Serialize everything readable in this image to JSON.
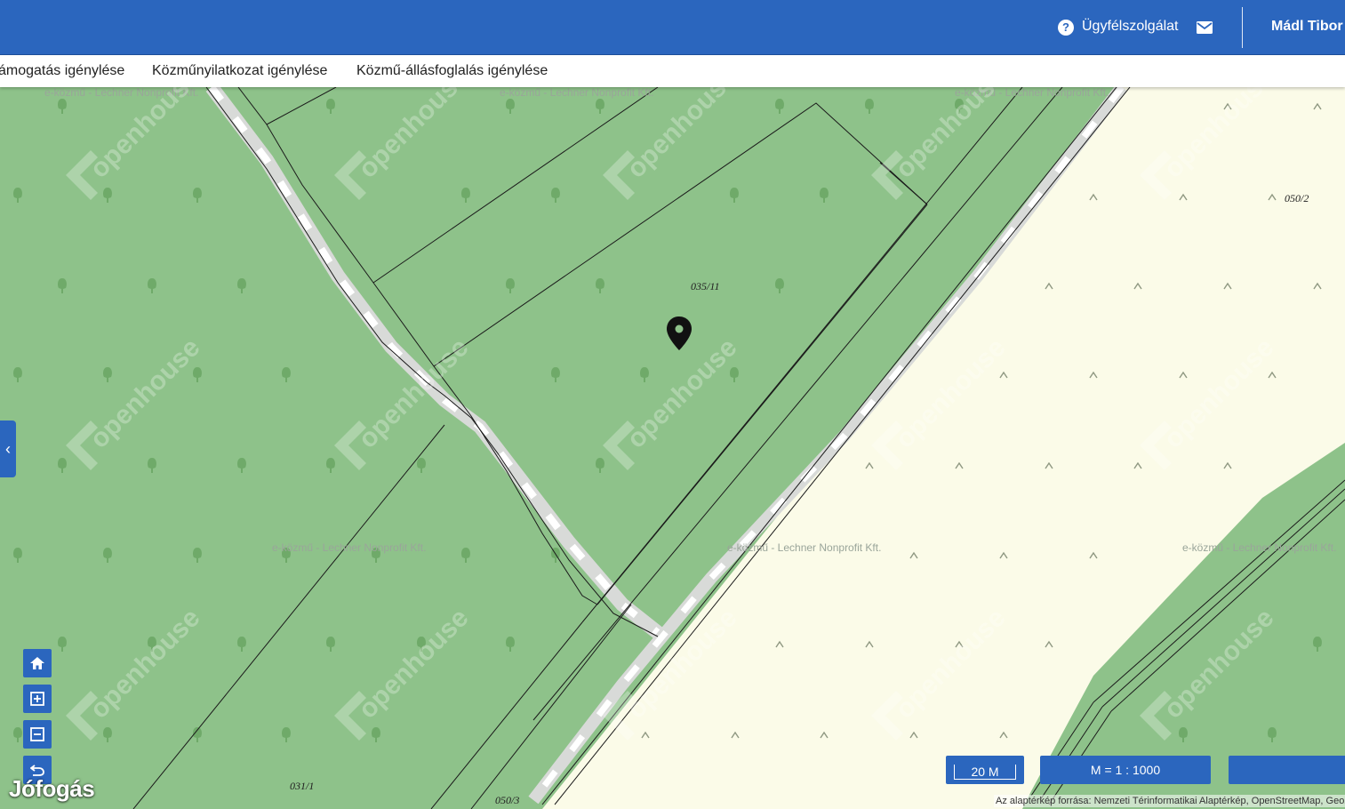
{
  "header": {
    "help_icon": "?",
    "help_label": "Ügyfélszolgálat",
    "mail_icon": "mail-icon",
    "user_name": "Mádl Tibor I"
  },
  "menu": {
    "items": [
      {
        "label": "ámogatás igénylése"
      },
      {
        "label": "Közműnyilatkozat igénylése"
      },
      {
        "label": "Közmű-állásfoglalás igénylése"
      }
    ]
  },
  "map": {
    "parcels": [
      "035/11",
      "050/2",
      "031/1",
      "050/3"
    ],
    "source_label": "e-közmű - Lechner Nonprofit Kft.",
    "marker_icon": "location-pin-icon",
    "colors": {
      "forest": "#8ec28a",
      "field": "#fbfbe8",
      "road": "#d9dcd9",
      "accent": "#2b66be"
    }
  },
  "controls": {
    "home_icon": "home-icon",
    "zoom_in_icon": "zoom-in-icon",
    "zoom_out_icon": "zoom-out-icon",
    "back_icon": "undo-icon",
    "sidebar_toggle": "‹"
  },
  "scale": {
    "bar_label": "20 M",
    "ratio_label": "M = 1 : 1000"
  },
  "attribution": "Az alaptérkép forrása: Nemzeti Térinformatikai Alaptérkép, OpenStreetMap, GeoX",
  "watermark": {
    "brand": "openhouse",
    "site": "Jófogás"
  }
}
